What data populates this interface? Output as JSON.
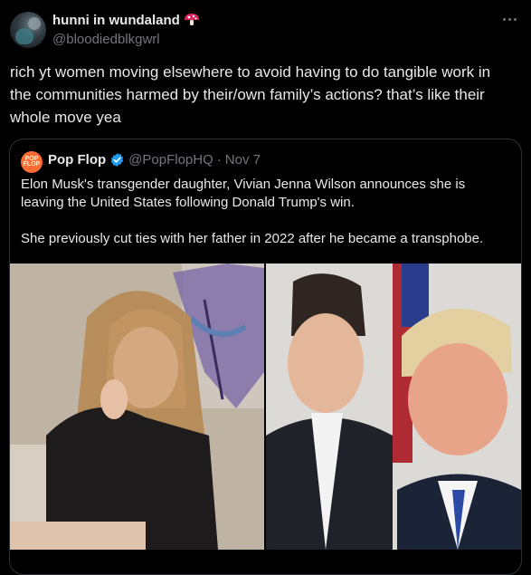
{
  "author": {
    "display_name": "hunni in wundaland",
    "handle": "@bloodiedblkgwrl",
    "emoji_icon": "mushroom-icon"
  },
  "tweet": {
    "text_lines": [
      "rich yt women moving elsewhere to avoid having to do tangible work in",
      "the communities harmed by their/own family’s actions? that’s like their",
      "whole move yea"
    ]
  },
  "quote": {
    "name": "Pop Flop",
    "handle": "@PopFlopHQ",
    "separator": "·",
    "date": "Nov 7",
    "avatar_text": "POP FLOP",
    "text_lines": [
      "Elon Musk's transgender daughter, Vivian Jenna Wilson announces she is",
      "leaving the United States following Donald Trump's win.",
      "",
      "She previously cut ties with her father in 2022 after he became a transphobe."
    ]
  },
  "colors": {
    "background": "#000000",
    "text": "#e7e9ea",
    "muted": "#71767b",
    "verified": "#1d9bf0",
    "border": "#2f3336"
  }
}
